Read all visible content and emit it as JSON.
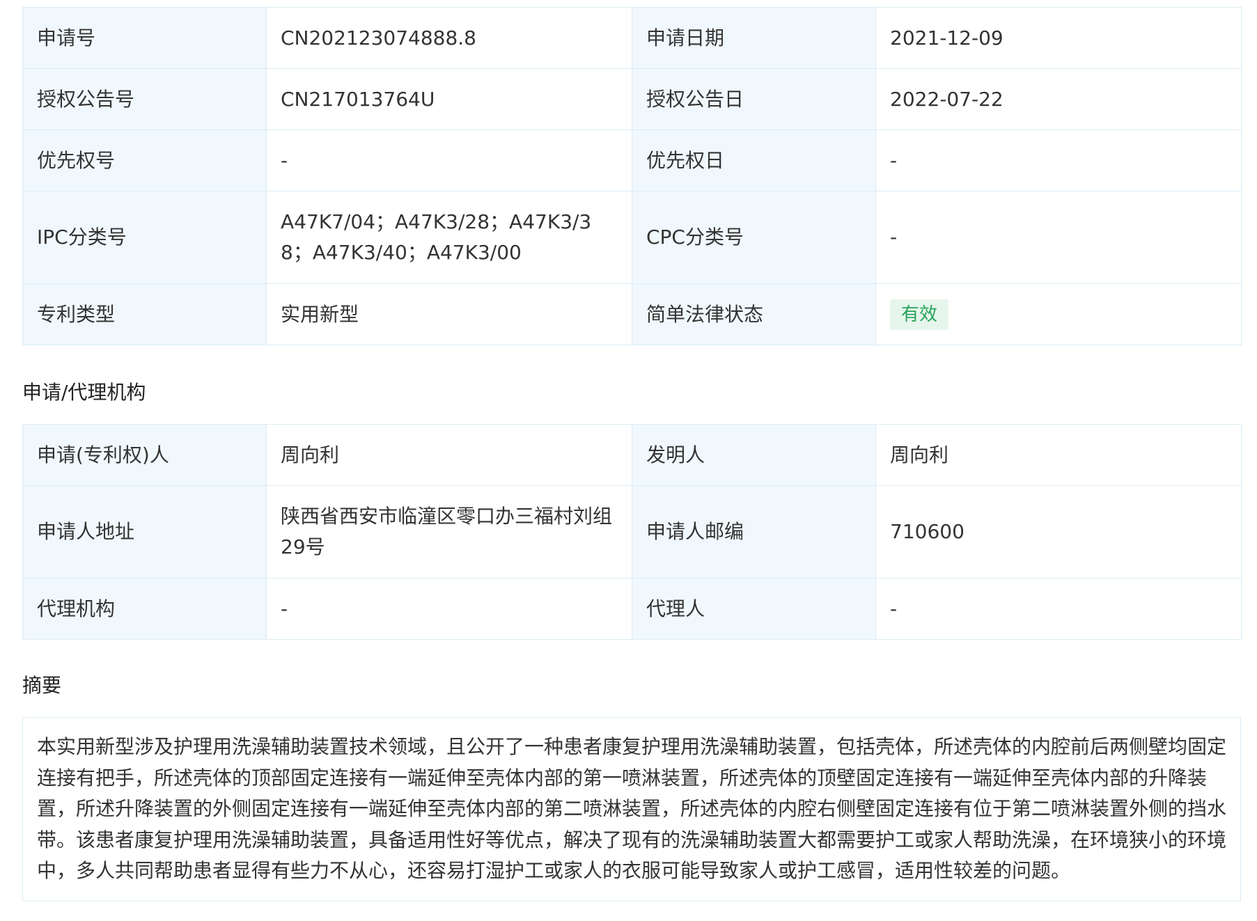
{
  "basic": {
    "rows": [
      {
        "label1": "申请号",
        "value1": "CN202123074888.8",
        "label2": "申请日期",
        "value2": "2021-12-09"
      },
      {
        "label1": "授权公告号",
        "value1": "CN217013764U",
        "label2": "授权公告日",
        "value2": "2022-07-22"
      },
      {
        "label1": "优先权号",
        "value1": "-",
        "label2": "优先权日",
        "value2": "-"
      },
      {
        "label1": "IPC分类号",
        "value1": "A47K7/04；A47K3/28；A47K3/38；A47K3/40；A47K3/00",
        "label2": "CPC分类号",
        "value2": "-"
      },
      {
        "label1": "专利类型",
        "value1": "实用新型",
        "label2": "简单法律状态",
        "value2": "有效"
      }
    ]
  },
  "agency": {
    "title": "申请/代理机构",
    "rows": [
      {
        "label1": "申请(专利权)人",
        "value1": "周向利",
        "label2": "发明人",
        "value2": "周向利"
      },
      {
        "label1": "申请人地址",
        "value1": "陕西省西安市临潼区零口办三福村刘组29号",
        "label2": "申请人邮编",
        "value2": "710600"
      },
      {
        "label1": "代理机构",
        "value1": "-",
        "label2": "代理人",
        "value2": "-"
      }
    ]
  },
  "abstract": {
    "title": "摘要",
    "text": "本实用新型涉及护理用洗澡辅助装置技术领域，且公开了一种患者康复护理用洗澡辅助装置，包括壳体，所述壳体的内腔前后两侧壁均固定连接有把手，所述壳体的顶部固定连接有一端延伸至壳体内部的第一喷淋装置，所述壳体的顶壁固定连接有一端延伸至壳体内部的升降装置，所述升降装置的外侧固定连接有一端延伸至壳体内部的第二喷淋装置，所述壳体的内腔右侧壁固定连接有位于第二喷淋装置外侧的挡水带。该患者康复护理用洗澡辅助装置，具备适用性好等优点，解决了现有的洗澡辅助装置大都需要护工或家人帮助洗澡，在环境狭小的环境中，多人共同帮助患者显得有些力不从心，还容易打湿护工或家人的衣服可能导致家人或护工感冒，适用性较差的问题。"
  },
  "colors": {
    "label_bg": "#f0f8fd",
    "border": "#dcecf5",
    "badge_bg": "#e6f6ec",
    "badge_text": "#27a35a"
  }
}
